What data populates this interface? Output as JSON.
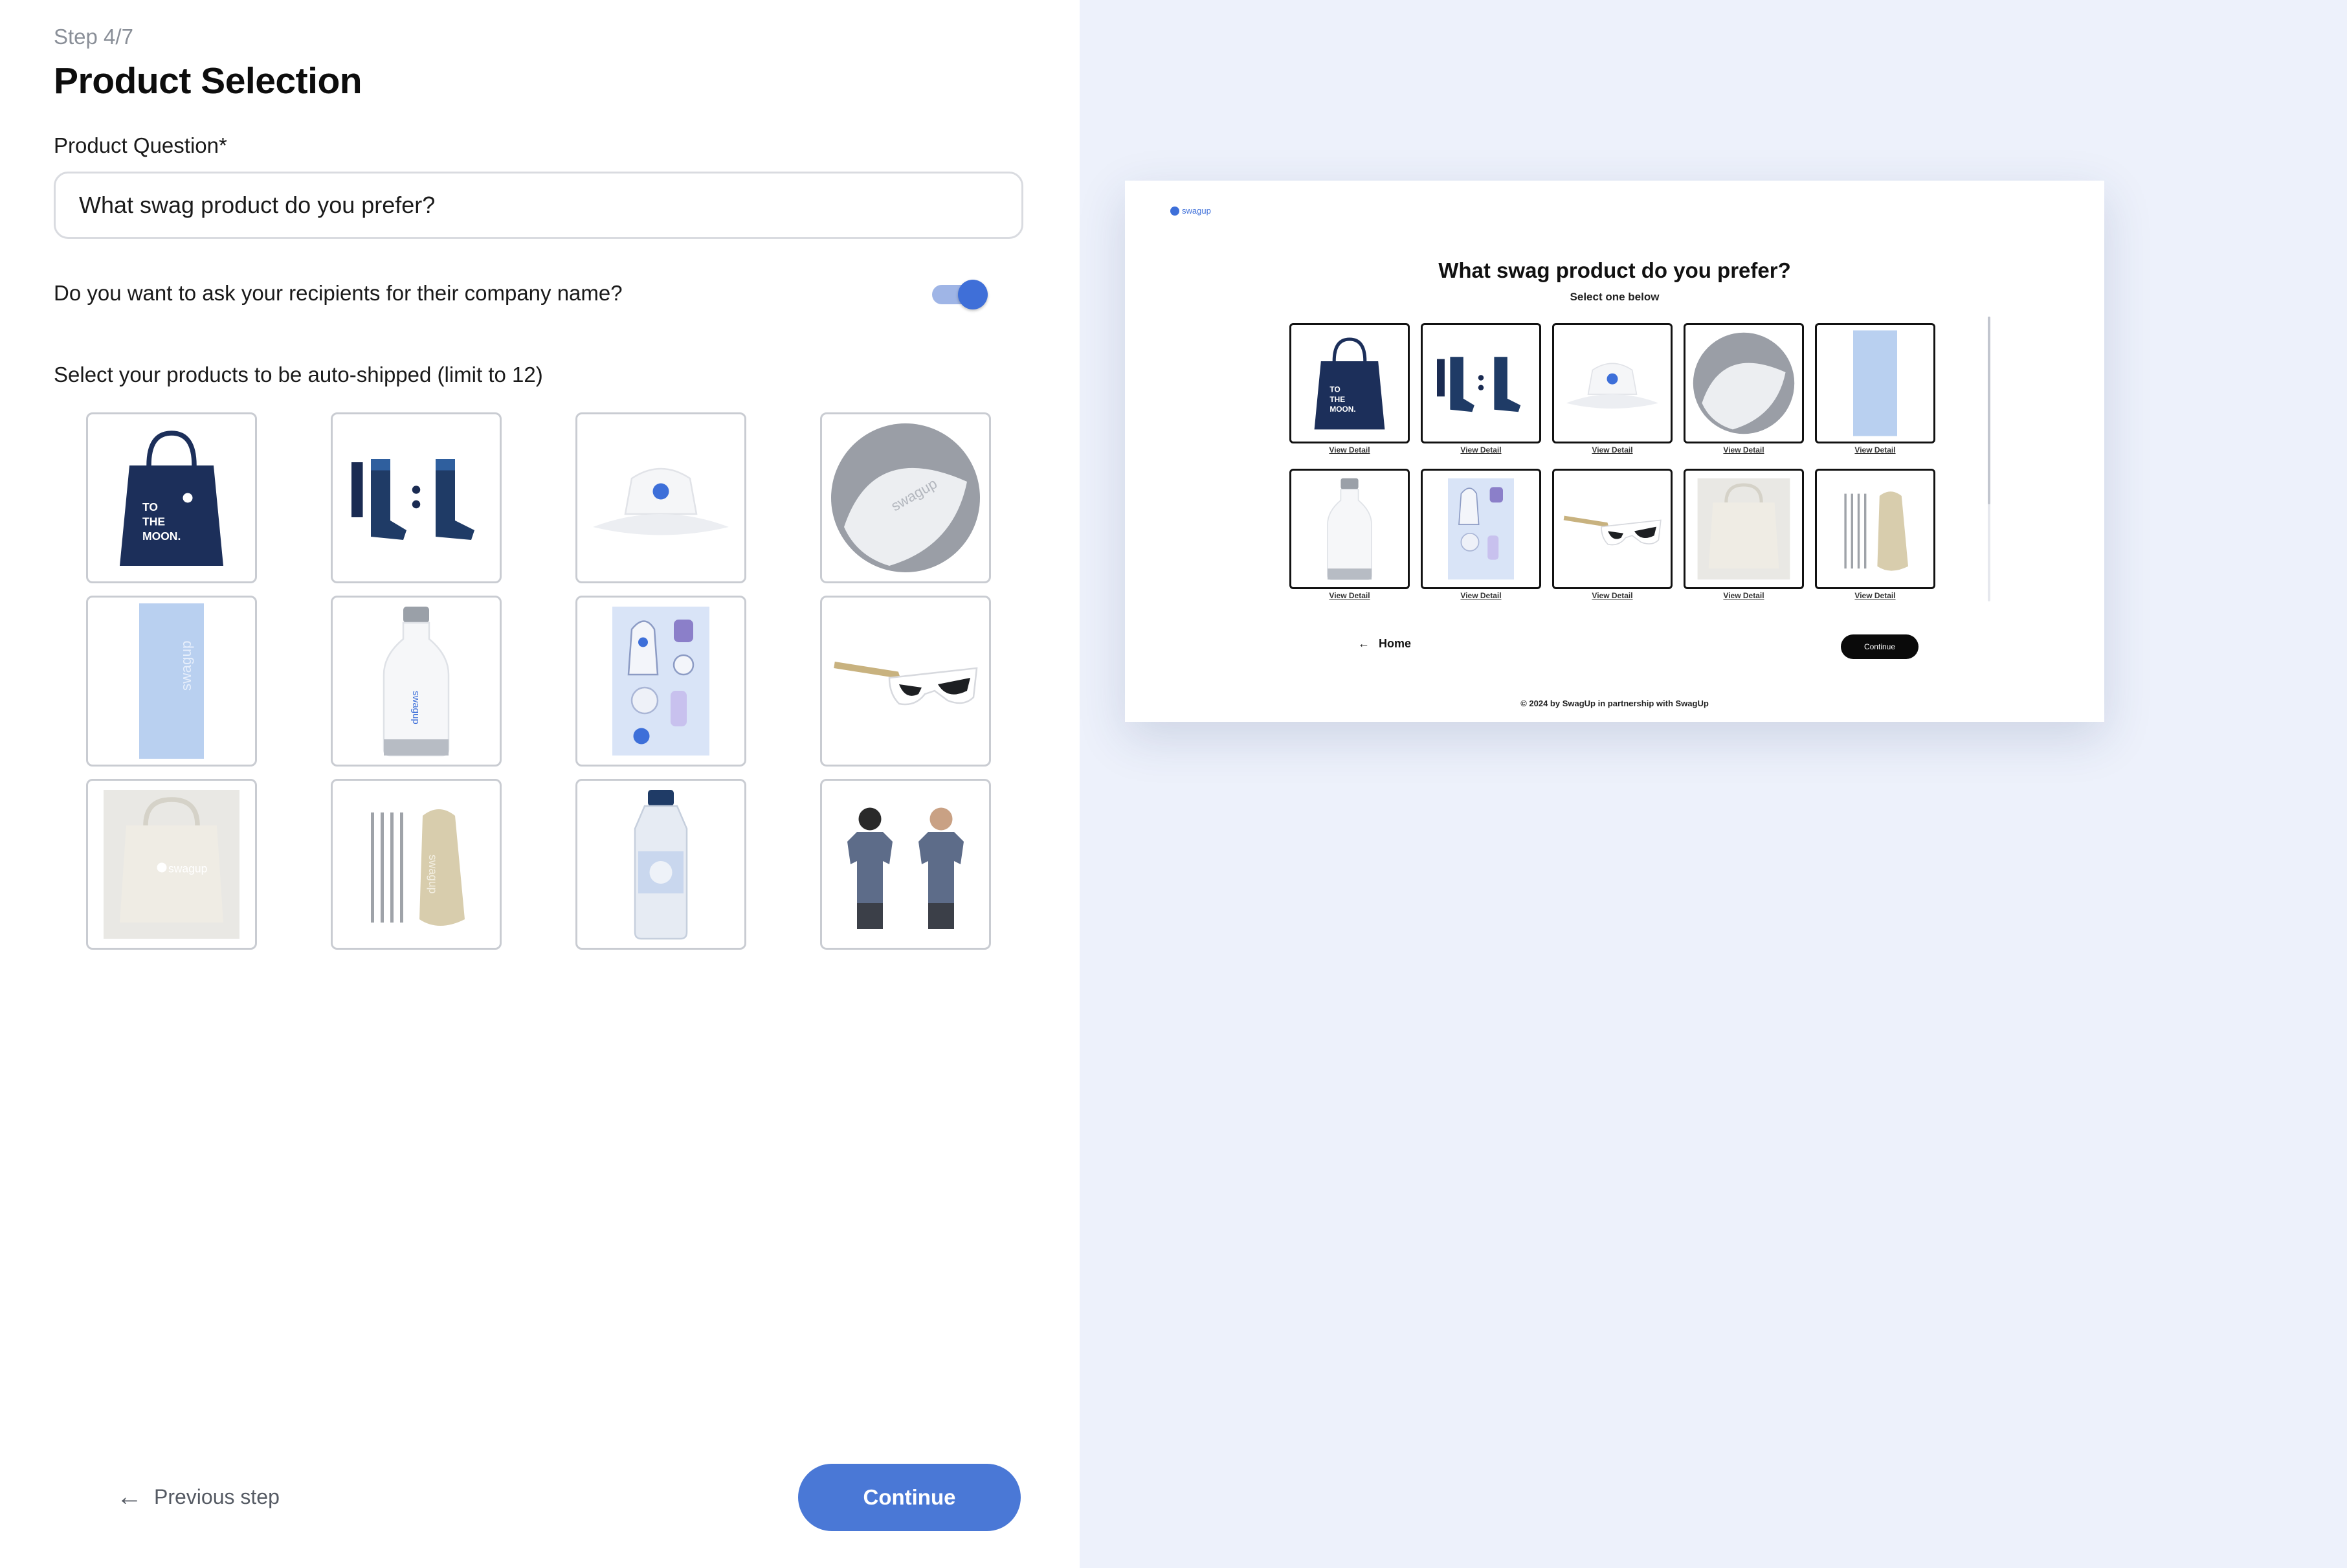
{
  "form": {
    "step": "Step 4/7",
    "title": "Product Selection",
    "question_label": "Product Question*",
    "question_value": "What swag product do you prefer?",
    "company_toggle_label": "Do you want to ask your recipients for their company name?",
    "company_toggle_on": true,
    "select_hint": "Select your products to be auto-shipped (limit to 12)",
    "products": [
      {
        "name": "tote bag",
        "icon": "tote-bag-icon"
      },
      {
        "name": "socks",
        "icon": "socks-icon"
      },
      {
        "name": "bucket hat",
        "icon": "bucket-hat-icon"
      },
      {
        "name": "beach ball",
        "icon": "beach-ball-icon"
      },
      {
        "name": "towel",
        "icon": "towel-icon"
      },
      {
        "name": "water bottle",
        "icon": "water-bottle-icon"
      },
      {
        "name": "sticker sheet",
        "icon": "sticker-sheet-icon"
      },
      {
        "name": "sunglasses",
        "icon": "sunglasses-icon"
      },
      {
        "name": "canvas bag",
        "icon": "canvas-bag-icon"
      },
      {
        "name": "straw set",
        "icon": "straw-set-icon"
      },
      {
        "name": "plastic bottle",
        "icon": "plastic-bottle-icon"
      },
      {
        "name": "t-shirts",
        "icon": "tshirt-icon"
      }
    ],
    "previous_label": "Previous step",
    "continue_label": "Continue"
  },
  "preview": {
    "logo_text": "swagup",
    "title": "What swag product do you prefer?",
    "subtitle": "Select one below",
    "view_detail_label": "View Detail",
    "home_label": "Home",
    "continue_label": "Continue",
    "footer": "© 2024 by SwagUp in partnership with SwagUp"
  },
  "colors": {
    "accent": "#4a78d6",
    "panel_bg": "#edf1fb",
    "navy": "#1c2f5a"
  }
}
